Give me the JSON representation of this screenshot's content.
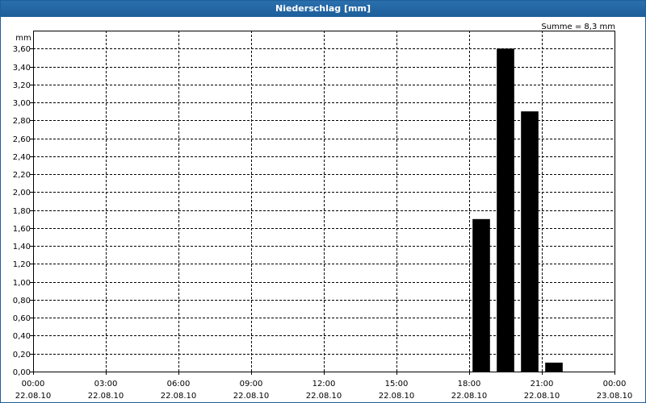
{
  "window": {
    "title": "Niederschlag [mm]"
  },
  "summary": "Summe = 8,3 mm",
  "colors": {
    "bar": "#000000",
    "title_bar": "#1c5e99",
    "grid": "#000000"
  },
  "chart_data": {
    "type": "bar",
    "title": "Niederschlag [mm]",
    "ylabel": "mm",
    "ylim": [
      0,
      3.8
    ],
    "yticks": [
      0,
      0.2,
      0.4,
      0.6,
      0.8,
      1.0,
      1.2,
      1.4,
      1.6,
      1.8,
      2.0,
      2.2,
      2.4,
      2.6,
      2.8,
      3.0,
      3.2,
      3.4,
      3.6
    ],
    "ytick_labels": [
      "0,00",
      "0,20",
      "0,40",
      "0,60",
      "0,80",
      "1,00",
      "1,20",
      "1,40",
      "1,60",
      "1,80",
      "2,00",
      "2,20",
      "2,40",
      "2,60",
      "2,80",
      "3,00",
      "3,20",
      "3,40",
      "3,60"
    ],
    "xlim_hours": [
      0,
      24
    ],
    "xticks_hours": [
      0,
      3,
      6,
      9,
      12,
      15,
      18,
      21,
      24
    ],
    "xtick_labels": [
      {
        "time": "00:00",
        "date": "22.08.10"
      },
      {
        "time": "03:00",
        "date": "22.08.10"
      },
      {
        "time": "06:00",
        "date": "22.08.10"
      },
      {
        "time": "09:00",
        "date": "22.08.10"
      },
      {
        "time": "12:00",
        "date": "22.08.10"
      },
      {
        "time": "15:00",
        "date": "22.08.10"
      },
      {
        "time": "18:00",
        "date": "22.08.10"
      },
      {
        "time": "21:00",
        "date": "22.08.10"
      },
      {
        "time": "00:00",
        "date": "23.08.10"
      }
    ],
    "bars": [
      {
        "start_hour": 18,
        "end_hour": 19,
        "value": 1.7
      },
      {
        "start_hour": 19,
        "end_hour": 20,
        "value": 3.6
      },
      {
        "start_hour": 20,
        "end_hour": 21,
        "value": 2.9
      },
      {
        "start_hour": 21,
        "end_hour": 22,
        "value": 0.1
      }
    ],
    "grid": true,
    "summary_text": "Summe = 8,3 mm"
  }
}
